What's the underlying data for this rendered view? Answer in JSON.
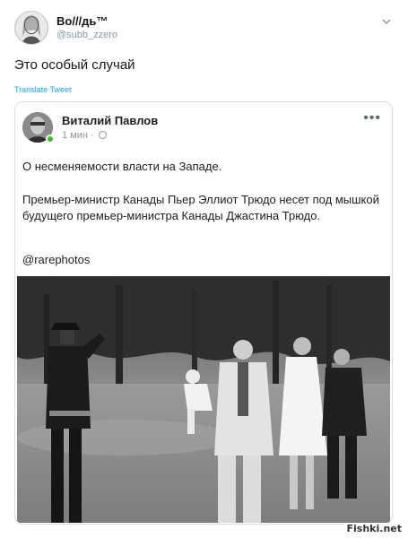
{
  "tweet": {
    "author_name": "Во///дь™",
    "author_handle": "@subb_zzero",
    "text": "Это особый случай",
    "translate_label": "Translate Tweet",
    "menu_icon": "chevron-down-icon"
  },
  "embedded_post": {
    "author_name": "Виталий Павлов",
    "time": "1 мин ·",
    "privacy_icon": "globe-icon",
    "more_label": "•••",
    "paragraph_1": "О несменяемости власти на Западе.",
    "paragraph_2": "Премьер-министр Канады Пьер Эллиот Трюдо несет под мышкой будущего премьер-министра Канады Джастина Трюдо.",
    "paragraph_3": "@rarephotos",
    "online_status_color": "#42b72a"
  },
  "watermark": "Fishki.net"
}
